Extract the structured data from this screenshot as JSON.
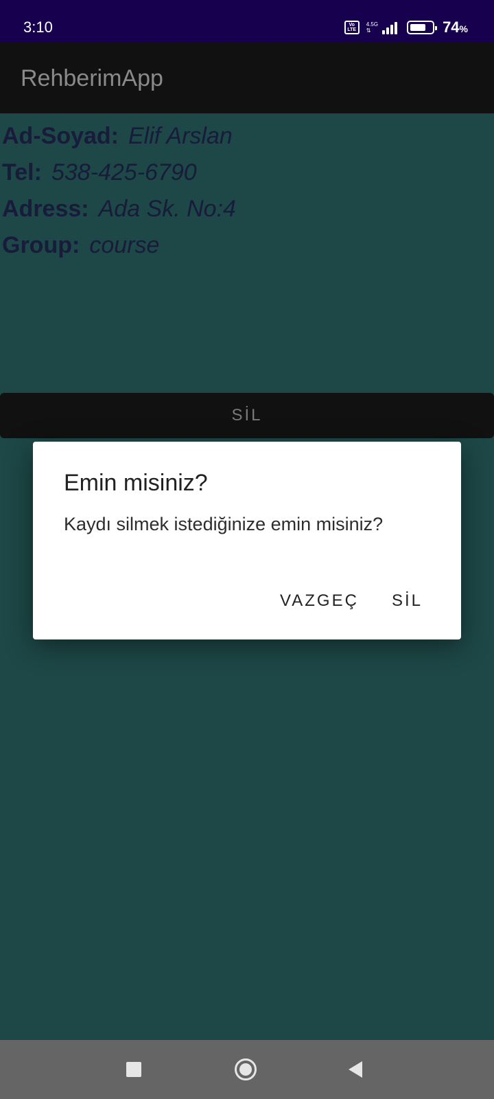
{
  "status_bar": {
    "time": "3:10",
    "volte_icon_text": "Vo LTE",
    "network_type": "4.5G",
    "network_arrows": "⇅",
    "battery_percent_value": "74",
    "battery_percent_sign": "%",
    "battery_level": 0.74
  },
  "app_bar": {
    "title": "RehberimApp"
  },
  "contact": {
    "name_label": "Ad-Soyad:",
    "name_value": "Elif Arslan",
    "tel_label": "Tel:",
    "tel_value": "538-425-6790",
    "address_label": "Adress:",
    "address_value": "Ada Sk. No:4",
    "group_label": "Group:",
    "group_value": "course"
  },
  "delete_button": {
    "label": "SİL"
  },
  "dialog": {
    "title": "Emin misiniz?",
    "message": "Kaydı silmek istediğinize emin misiniz?",
    "cancel_label": "VAZGEÇ",
    "confirm_label": "SİL"
  },
  "nav_bar": {
    "icons": [
      "recents-icon",
      "home-icon",
      "back-icon"
    ]
  },
  "colors": {
    "status_bar": "#17004e",
    "app_bar": "#111111",
    "background": "#1d4847",
    "dialog_bg": "#ffffff",
    "nav_bar": "#656565"
  }
}
